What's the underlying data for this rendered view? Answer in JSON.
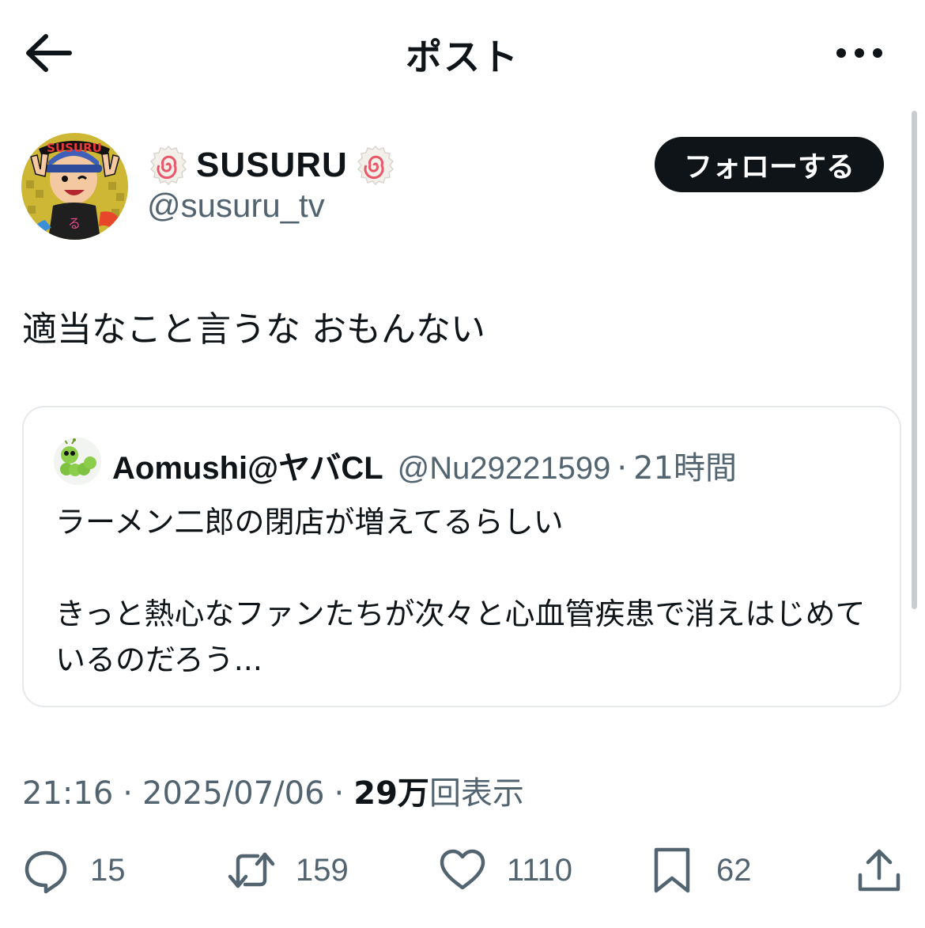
{
  "header": {
    "title": "ポスト",
    "back_icon": "arrow-left-icon",
    "more_icon": "ellipsis-icon"
  },
  "author": {
    "display_name": "SUSURU",
    "name_emoji": "naruto-icon",
    "handle": "@susuru_tv",
    "avatar_text": "SUSURU",
    "follow_label": "フォローする"
  },
  "post": {
    "text": "適当なこと言うな おもんない"
  },
  "quote": {
    "display_name": "Aomushi@ヤバCL",
    "handle": "@Nu29221599",
    "separator": "·",
    "time": "21時間",
    "text": "ラーメン二郎の閉店が増えてるらしい\n\nきっと熱心なファンたちが次々と心血管疾患で消えはじめているのだろう..."
  },
  "meta": {
    "time": "21:16",
    "separator": "·",
    "date": "2025/07/06",
    "views_count": "29万",
    "views_label": "回表示"
  },
  "actions": {
    "reply": {
      "icon": "reply-icon",
      "count": "15"
    },
    "repost": {
      "icon": "repost-icon",
      "count": "159"
    },
    "like": {
      "icon": "heart-icon",
      "count": "1110"
    },
    "bookmark": {
      "icon": "bookmark-icon",
      "count": "62"
    },
    "share": {
      "icon": "share-icon"
    }
  },
  "colors": {
    "text": "#0f1419",
    "secondary": "#536471",
    "button": "#0f1419",
    "border": "#e6e9ec"
  }
}
